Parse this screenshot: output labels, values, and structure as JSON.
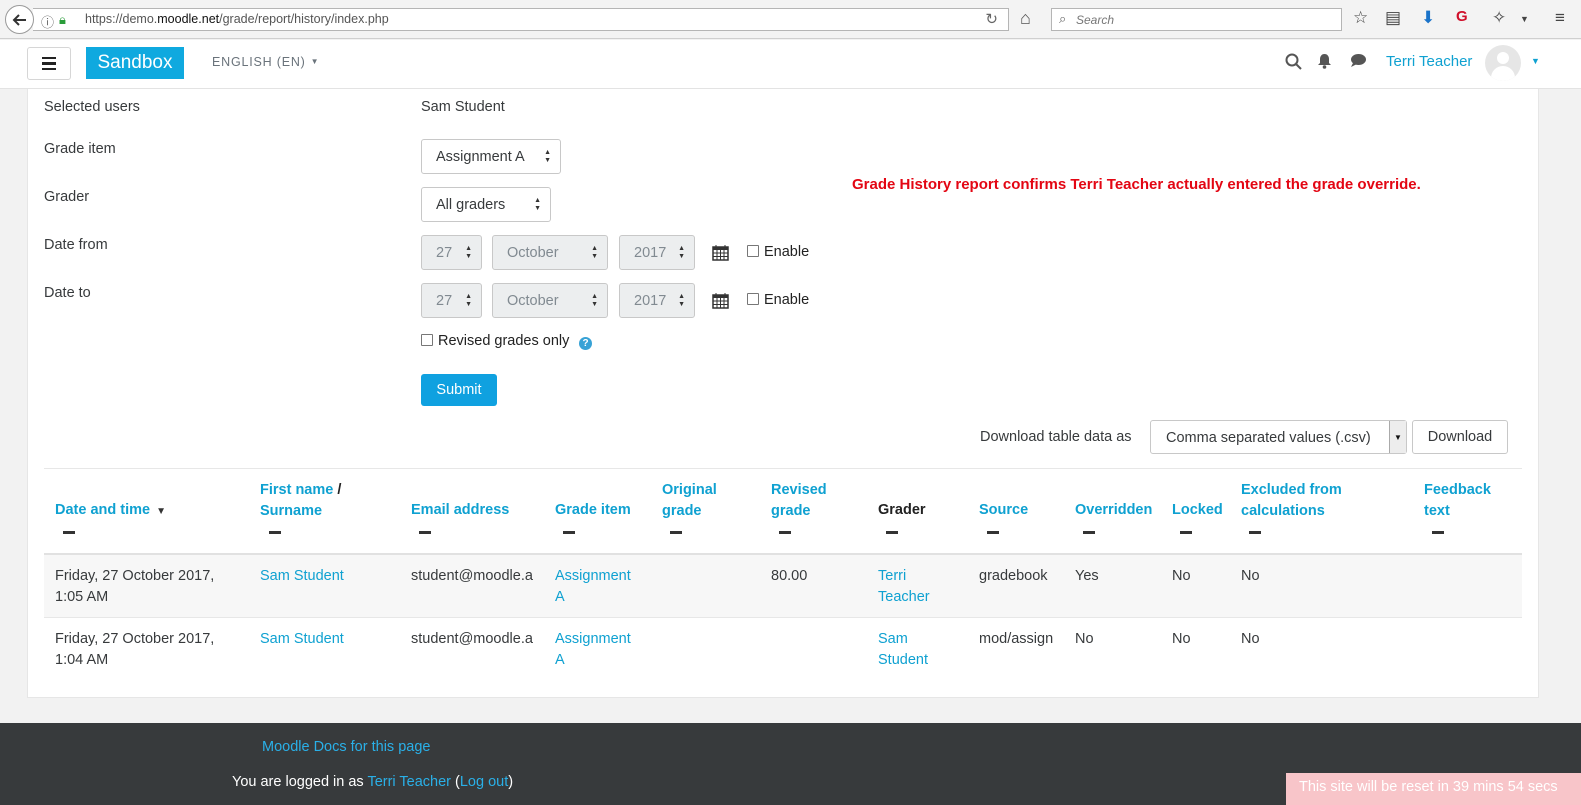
{
  "browser": {
    "url_prefix": "https://demo.",
    "url_domain": "moodle.net",
    "url_path": "/grade/report/history/index.php",
    "search_placeholder": "Search"
  },
  "navbar": {
    "brand": "Sandbox",
    "language": "ENGLISH (EN)",
    "user_name": "Terri Teacher"
  },
  "form": {
    "selected_users_label": "Selected users",
    "selected_users_value": "Sam Student",
    "grade_item_label": "Grade item",
    "grade_item_value": "Assignment A",
    "grader_label": "Grader",
    "grader_value": "All graders",
    "date_from_label": "Date from",
    "date_to_label": "Date to",
    "date_from": {
      "day": "27",
      "month": "October",
      "year": "2017"
    },
    "date_to": {
      "day": "27",
      "month": "October",
      "year": "2017"
    },
    "enable_label": "Enable",
    "revised_only_label": "Revised grades only",
    "help_glyph": "?",
    "submit_label": "Submit"
  },
  "annotation": "Grade History report confirms Terri Teacher actually entered the grade override.",
  "download": {
    "label": "Download table data as",
    "format": "Comma separated values (.csv)",
    "button": "Download"
  },
  "table": {
    "headers": {
      "date": "Date and time",
      "first_name": "First name",
      "slash": " /",
      "surname": "Surname",
      "email": "Email address",
      "grade_item": "Grade item",
      "original_1": "Original",
      "original_2": "grade",
      "revised_1": "Revised",
      "revised_2": "grade",
      "grader": "Grader",
      "source": "Source",
      "overridden": "Overridden",
      "locked": "Locked",
      "excluded_1": "Excluded from",
      "excluded_2": "calculations",
      "feedback_1": "Feedback",
      "feedback_2": "text"
    },
    "rows": [
      {
        "date_1": "Friday, 27 October 2017,",
        "date_2": "1:05 AM",
        "name": "Sam Student",
        "email": "student@moodle.a",
        "item_1": "Assignment",
        "item_2": "A",
        "original": "",
        "revised": "80.00",
        "grader_1": "Terri",
        "grader_2": "Teacher",
        "source": "gradebook",
        "overridden": "Yes",
        "locked": "No",
        "excluded": "No",
        "feedback": ""
      },
      {
        "date_1": "Friday, 27 October 2017,",
        "date_2": "1:04 AM",
        "name": "Sam Student",
        "email": "student@moodle.a",
        "item_1": "Assignment",
        "item_2": "A",
        "original": "",
        "revised": "",
        "grader_1": "Sam",
        "grader_2": "Student",
        "source": "mod/assign",
        "overridden": "No",
        "locked": "No",
        "excluded": "No",
        "feedback": ""
      }
    ]
  },
  "footer": {
    "docs_link": "Moodle Docs for this page",
    "logged_in_prefix": "You are logged in as ",
    "logged_in_user": "Terri Teacher",
    "open_paren": " (",
    "logout": "Log out",
    "close_paren": ")"
  },
  "reset_notice": "This site will be reset in 39 mins 54 secs"
}
